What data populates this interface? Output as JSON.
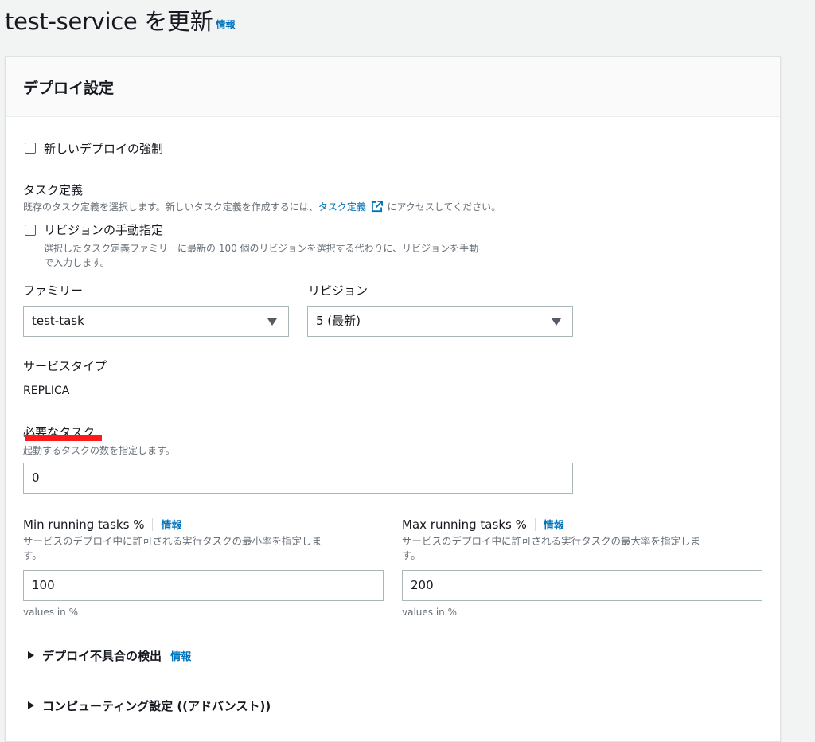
{
  "page": {
    "title": "test-service を更新",
    "info": "情報"
  },
  "panel": {
    "title": "デプロイ設定"
  },
  "force_deploy": {
    "label": "新しいデプロイの強制",
    "checked": false
  },
  "task_definition": {
    "label": "タスク定義",
    "desc_before": "既存のタスク定義を選択します。新しいタスク定義を作成するには、",
    "desc_link": "タスク定義",
    "desc_after": "にアクセスしてください。",
    "external_icon": "external-link-icon"
  },
  "manual_revision": {
    "label": "リビジョンの手動指定",
    "checked": false,
    "desc_line1": "選択したタスク定義ファミリーに最新の 100 個のリビジョンを選択する代わりに、リビジョンを手動",
    "desc_line2": "で入力します。"
  },
  "family": {
    "label": "ファミリー",
    "value": "test-task"
  },
  "revision": {
    "label": "リビジョン",
    "value": "5 (最新)"
  },
  "service_type": {
    "label": "サービスタイプ",
    "value": "REPLICA"
  },
  "desired_tasks": {
    "label": "必要なタスク",
    "desc": "起動するタスクの数を指定します。",
    "value": "0"
  },
  "min_running": {
    "label": "Min running tasks %",
    "info": "情報",
    "desc_line1": "サービスのデプロイ中に許可される実行タスクの最小率を指定しま",
    "desc_line2": "す。",
    "value": "100",
    "hint": "values in %"
  },
  "max_running": {
    "label": "Max running tasks %",
    "info": "情報",
    "desc_line1": "サービスのデプロイ中に許可される実行タスクの最大率を指定しま",
    "desc_line2": "す。",
    "value": "200",
    "hint": "values in %"
  },
  "deploy_failure": {
    "label": "デプロイ不具合の検出",
    "info": "情報"
  },
  "compute_settings": {
    "label": "コンピューティング設定 ((アドバンスト))"
  },
  "colors": {
    "link": "#0073bb",
    "annotation": "#ff1a1a"
  }
}
